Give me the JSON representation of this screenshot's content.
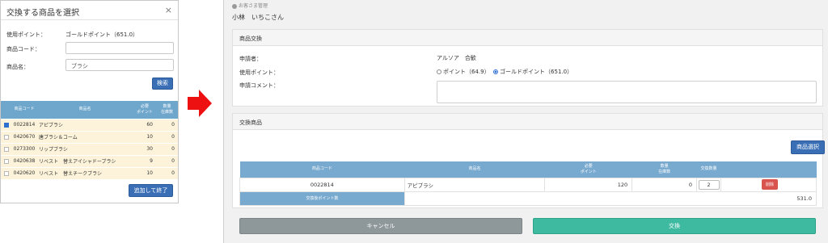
{
  "modal": {
    "title": "交換する商品を選択",
    "close": "×",
    "points_label": "使用ポイント：",
    "points_value": "ゴールドポイント（651.0）",
    "code_label": "商品コード：",
    "code_value": "",
    "name_label": "商品名：",
    "name_value": "ブラシ",
    "search_button": "検索",
    "table_headers": [
      "商品コード",
      "商品名",
      "必要\nポイント",
      "数量\n在庫数"
    ],
    "rows": [
      {
        "checked": true,
        "code": "0022814",
        "name": "アピブラシ",
        "points": "60",
        "stock": "0"
      },
      {
        "checked": false,
        "code": "0420670",
        "name": "唐ブラシ＆コーム",
        "points": "10",
        "stock": "0"
      },
      {
        "checked": false,
        "code": "0273300",
        "name": "リップブラシ",
        "points": "30",
        "stock": "0"
      },
      {
        "checked": false,
        "code": "0420638",
        "name": "リベスト　替えアイシャドーブラシ",
        "points": "9",
        "stock": "0"
      },
      {
        "checked": false,
        "code": "0420620",
        "name": "リベスト　替えチークブラシ",
        "points": "10",
        "stock": "0"
      }
    ],
    "add_button": "追加して終了"
  },
  "main": {
    "breadcrumb": "お客さま管理",
    "username": "小林　いちこさん",
    "exchange_panel": {
      "title": "商品交換",
      "applicant_label": "申請者：",
      "applicant_value": "アルソア　合歓",
      "points_label": "使用ポイント：",
      "point_option_1": "ポイント（64.9）",
      "point_option_2": "ゴールドポイント（651.0）",
      "comment_label": "申請コメント："
    },
    "items_panel": {
      "title": "交換商品",
      "select_button": "商品選択",
      "table_headers": [
        "商品コード",
        "商品名",
        "必要\nポイント",
        "数量\n在庫数",
        "交換数量",
        ""
      ],
      "row": {
        "code": "0022814",
        "name": "アピブラシ",
        "points": "120",
        "stock": "0",
        "qty": "2",
        "delete": "削除"
      },
      "sum_label": "交換後ポイント数",
      "sum_value": "531.0"
    },
    "cancel_button": "キャンセル",
    "exchange_button": "交換"
  },
  "colors": {
    "primary_blue": "#3a6fb6",
    "table_header": "#6ea6cc",
    "row_highlight": "#fdf3da",
    "arrow": "#ee1111",
    "exchange": "#3dbaa0",
    "cancel": "#8e979a",
    "delete": "#d9534f"
  }
}
